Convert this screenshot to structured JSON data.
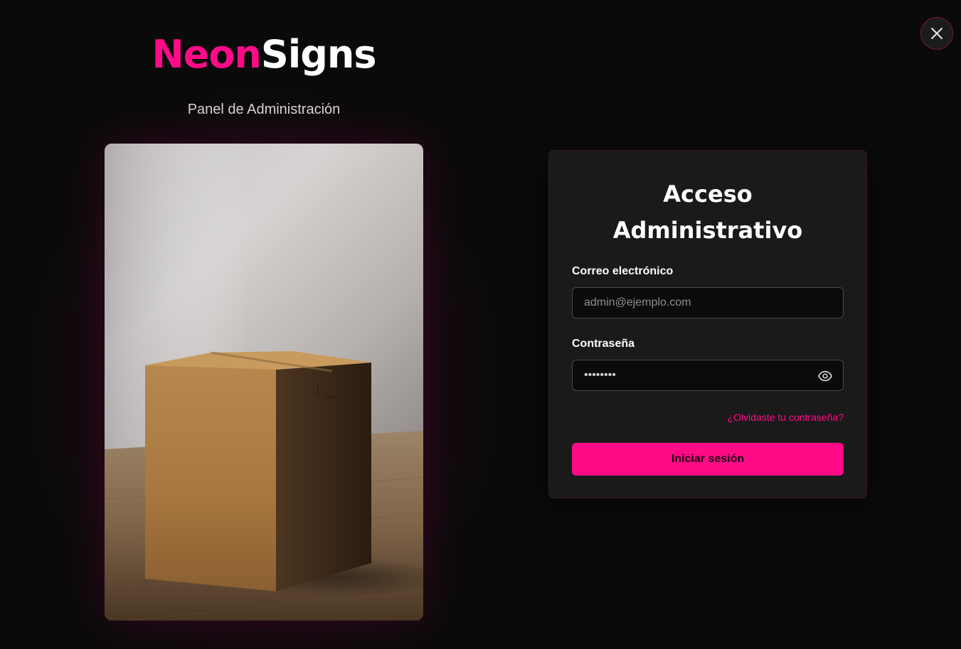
{
  "brand": {
    "neon": "Neon",
    "signs": "Signs",
    "subtitle": "Panel de Administración"
  },
  "close_icon": "close-icon",
  "login": {
    "title_line1": "Acceso",
    "title_line2": "Administrativo",
    "email_label": "Correo electrónico",
    "email_placeholder": "admin@ejemplo.com",
    "email_value": "",
    "password_label": "Contraseña",
    "password_value": "demopass",
    "password_toggle_icon": "eye-icon",
    "forgot_link": "¿Olvidaste tu contraseña?",
    "submit_label": "Iniciar sesión"
  },
  "colors": {
    "accent": "#ff0a87",
    "background": "#0b0a0b",
    "card": "#1a1a1b"
  }
}
